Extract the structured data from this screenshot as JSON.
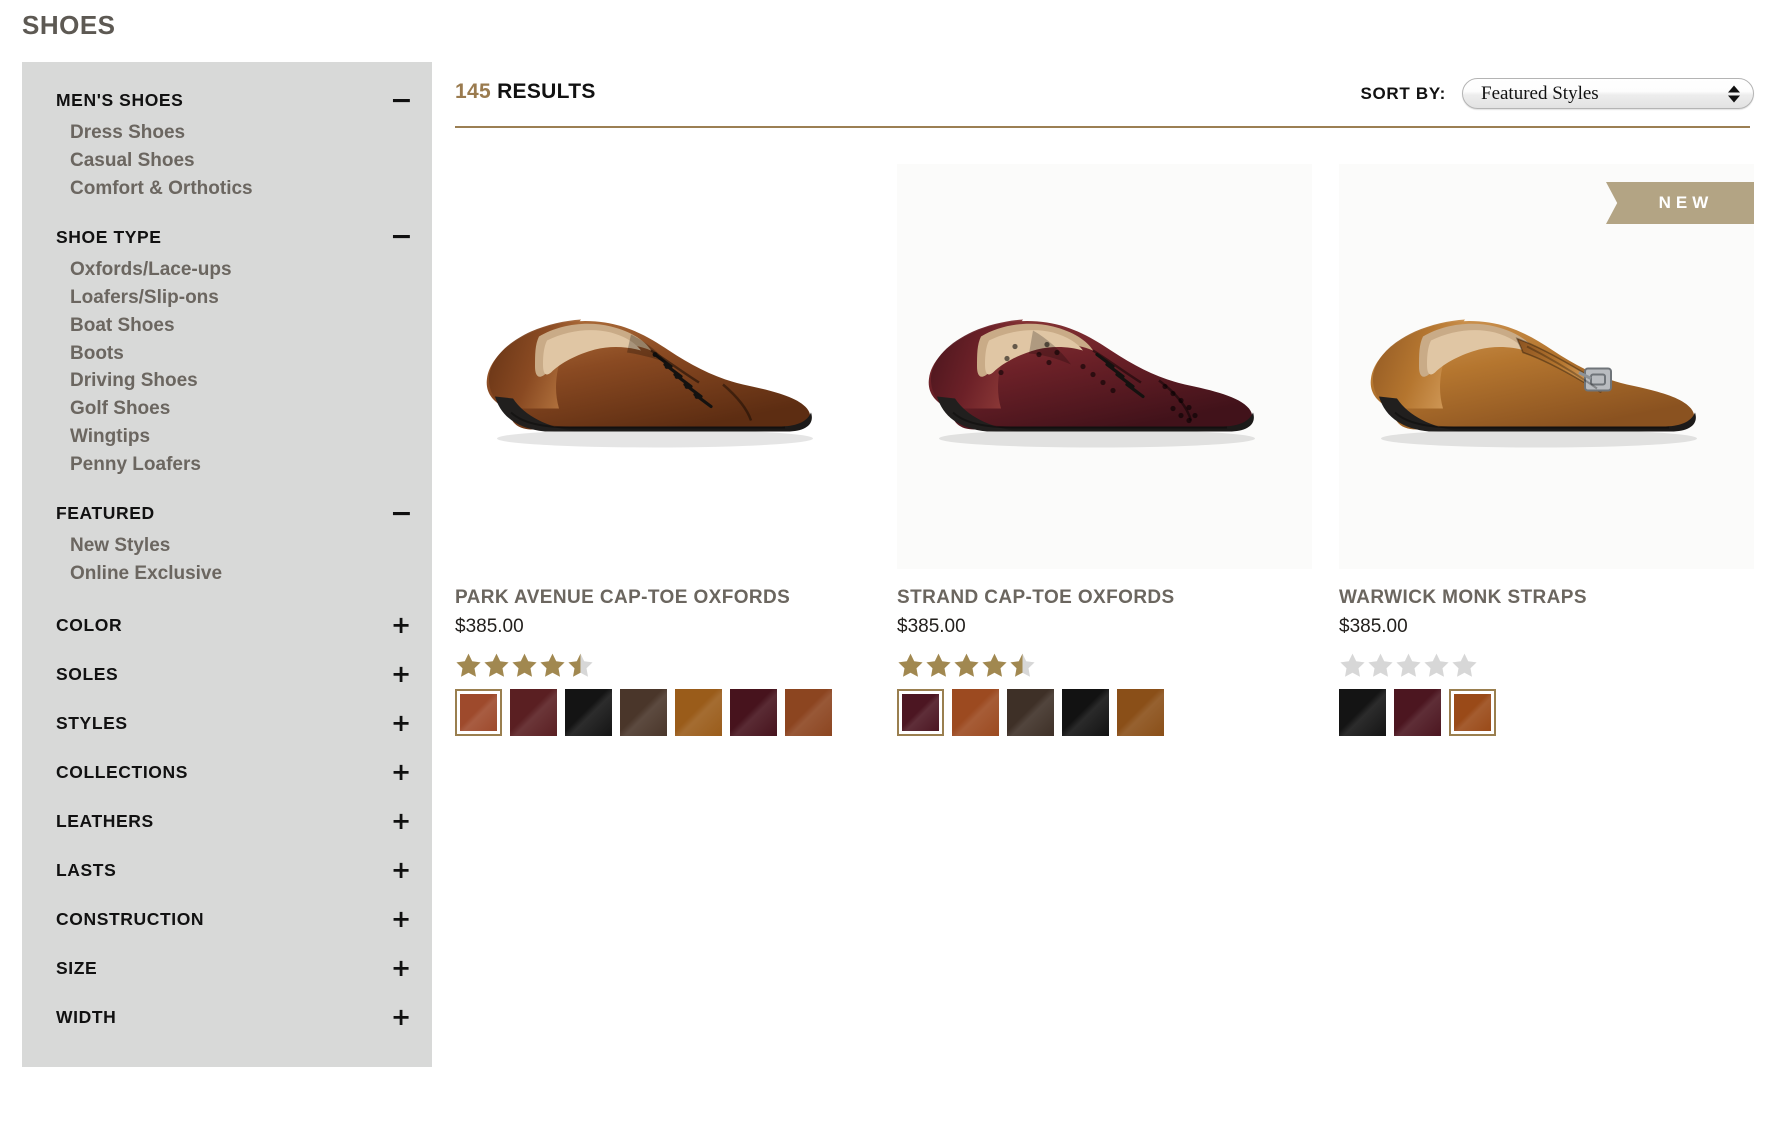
{
  "page": {
    "title": "SHOES"
  },
  "sidebar": {
    "groups": [
      {
        "title": "MEN'S SHOES",
        "toggle": "minus",
        "expanded": true,
        "items": [
          "Dress Shoes",
          "Casual Shoes",
          "Comfort & Orthotics"
        ]
      },
      {
        "title": "SHOE TYPE",
        "toggle": "minus",
        "expanded": true,
        "items": [
          "Oxfords/Lace-ups",
          "Loafers/Slip-ons",
          "Boat Shoes",
          "Boots",
          "Driving Shoes",
          "Golf Shoes",
          "Wingtips",
          "Penny Loafers"
        ]
      },
      {
        "title": "FEATURED",
        "toggle": "minus",
        "expanded": true,
        "items": [
          "New Styles",
          "Online Exclusive"
        ]
      },
      {
        "title": "COLOR",
        "toggle": "plus",
        "expanded": false,
        "items": []
      },
      {
        "title": "SOLES",
        "toggle": "plus",
        "expanded": false,
        "items": []
      },
      {
        "title": "STYLES",
        "toggle": "plus",
        "expanded": false,
        "items": []
      },
      {
        "title": "COLLECTIONS",
        "toggle": "plus",
        "expanded": false,
        "items": []
      },
      {
        "title": "LEATHERS",
        "toggle": "plus",
        "expanded": false,
        "items": []
      },
      {
        "title": "LASTS",
        "toggle": "plus",
        "expanded": false,
        "items": []
      },
      {
        "title": "CONSTRUCTION",
        "toggle": "plus",
        "expanded": false,
        "items": []
      },
      {
        "title": "SIZE",
        "toggle": "plus",
        "expanded": false,
        "items": []
      },
      {
        "title": "WIDTH",
        "toggle": "plus",
        "expanded": false,
        "items": []
      }
    ]
  },
  "results": {
    "count": "145",
    "label": "RESULTS",
    "sort_label": "SORT BY:",
    "sort_value": "Featured Styles",
    "sort_options": [
      "Featured Styles"
    ]
  },
  "products": [
    {
      "name": "PARK AVENUE CAP-TOE OXFORDS",
      "price": "$385.00",
      "rating": 4.5,
      "badge": null,
      "shoe_color": "#8a4a22",
      "shoe_color_dark": "#5d2d12",
      "shoe_color_light": "#b5753f",
      "swatches": [
        "#9e4a2c",
        "#5a1f22",
        "#141414",
        "#4a362a",
        "#9a5c1a",
        "#47131d",
        "#8c4520"
      ],
      "selected_swatch": 0
    },
    {
      "name": "STRAND CAP-TOE OXFORDS",
      "price": "$385.00",
      "rating": 4.5,
      "badge": null,
      "shoe_color": "#6d2128",
      "shoe_color_dark": "#41121a",
      "shoe_color_light": "#8e3a38",
      "swatches": [
        "#4c1622",
        "#9c4a20",
        "#3e3027",
        "#121212",
        "#8a4f18"
      ],
      "selected_swatch": 0
    },
    {
      "name": "WARWICK MONK STRAPS",
      "price": "$385.00",
      "rating": 0,
      "badge": "NEW",
      "shoe_color": "#b5762f",
      "shoe_color_dark": "#8a5220",
      "shoe_color_light": "#d29a58",
      "swatches": [
        "#141414",
        "#4c1620",
        "#9a4a18"
      ],
      "selected_swatch": 2
    }
  ],
  "colors": {
    "accent": "#9a7b4f",
    "sidebar_bg": "#d8d9d8",
    "star_filled": "#a18850",
    "star_empty": "#d7d7d7",
    "ribbon": "#b3a484"
  }
}
